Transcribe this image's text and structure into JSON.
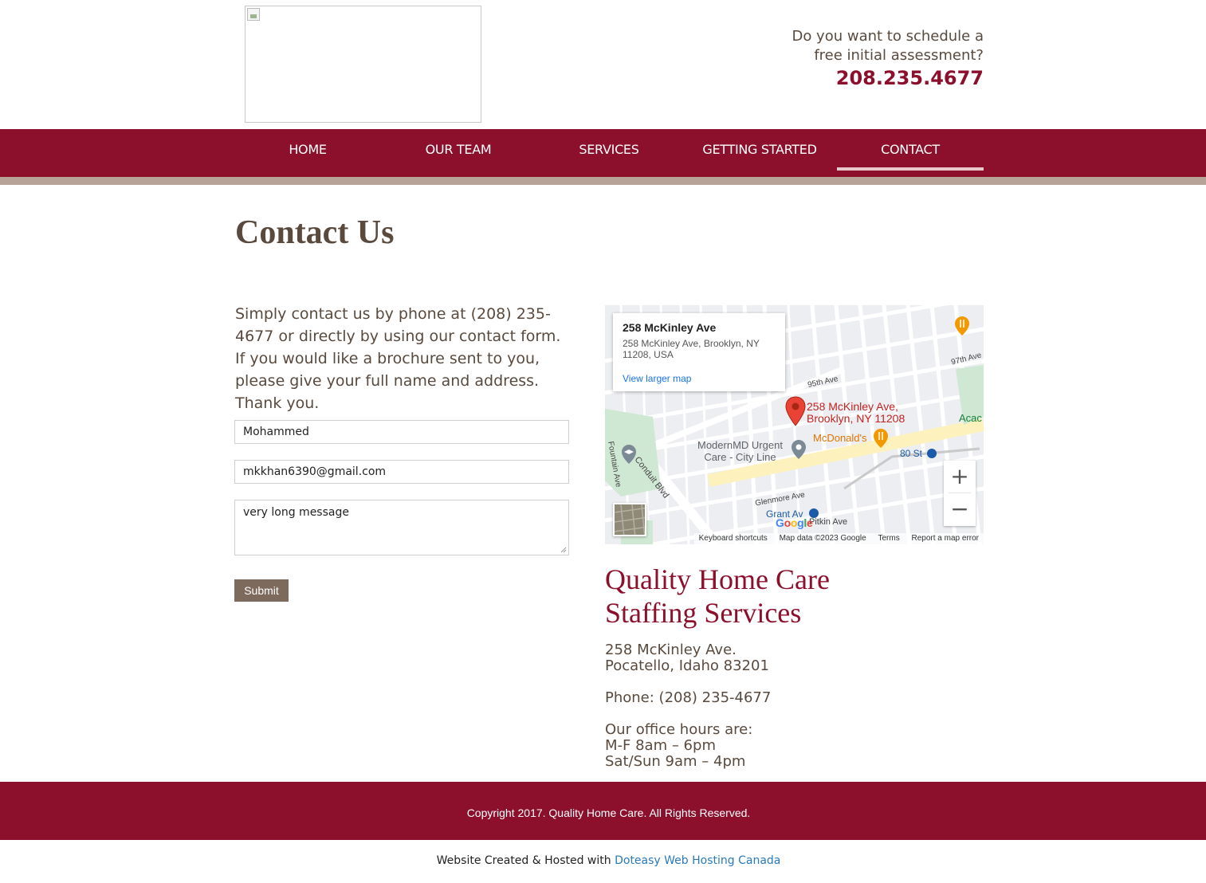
{
  "header": {
    "cta_line1": "Do you want to schedule a",
    "cta_line2": "free initial assessment?",
    "phone": "208.235.4677"
  },
  "nav": {
    "items": [
      "HOME",
      "OUR TEAM",
      "SERVICES",
      "GETTING STARTED",
      "CONTACT"
    ],
    "active": "CONTACT"
  },
  "page": {
    "title": "Contact Us",
    "intro": "Simply contact us by phone at (208) 235-4677 or directly by using our contact form. If you would like a brochure sent to you, please give your full name and address. Thank you."
  },
  "form": {
    "name_value": "Mohammed",
    "email_value": "mkkhan6390@gmail.com",
    "message_value": "very long message",
    "submit_label": "Submit"
  },
  "map": {
    "card_title": "258 McKinley Ave",
    "card_address": "258 McKinley Ave, Brooklyn, NY 11208, USA",
    "view_larger": "View larger map",
    "pin_label_1": "258 McKinley Ave,",
    "pin_label_2": "Brooklyn, NY 11208",
    "poi_mcdonalds": "McDonald's",
    "poi_urgent_1": "ModernMD Urgent",
    "poi_urgent_2": "Care - City Line",
    "station_80st": "80 St",
    "station_grant": "Grant Av",
    "street_conduit": "Conduit Blvd",
    "street_glenmore": "Glenmore Ave",
    "street_pitkin": "Pitkin Ave",
    "street_95th": "95th Ave",
    "street_97th": "97th Ave",
    "street_fountain": "Fountain Ave",
    "street_acac": "Acac",
    "zoom_in": "+",
    "zoom_out": "−",
    "google": "Google",
    "footer_keyboard": "Keyboard shortcuts",
    "footer_data": "Map data ©2023 Google",
    "footer_terms": "Terms",
    "footer_report": "Report a map error"
  },
  "company": {
    "name_line1": "Quality Home Care",
    "name_line2": "Staffing Services",
    "address_line1": "258 McKinley Ave.",
    "address_line2": "Pocatello, Idaho 83201",
    "phone": "Phone: (208) 235-4677",
    "hours_title": "Our office hours are:",
    "hours_weekday": "M-F 8am – 6pm",
    "hours_weekend": "Sat/Sun 9am – 4pm"
  },
  "footer": {
    "copyright": "Copyright 2017. Quality Home Care. All Rights Reserved.",
    "credit_prefix": "Website Created & Hosted with",
    "credit_link": "Doteasy Web Hosting Canada"
  },
  "colors": {
    "brand": "#8c0f2c",
    "text": "#5a4a3e",
    "nav_strip": "#b8a398",
    "submit": "#7e6a5c",
    "link": "#2a7ab8"
  }
}
